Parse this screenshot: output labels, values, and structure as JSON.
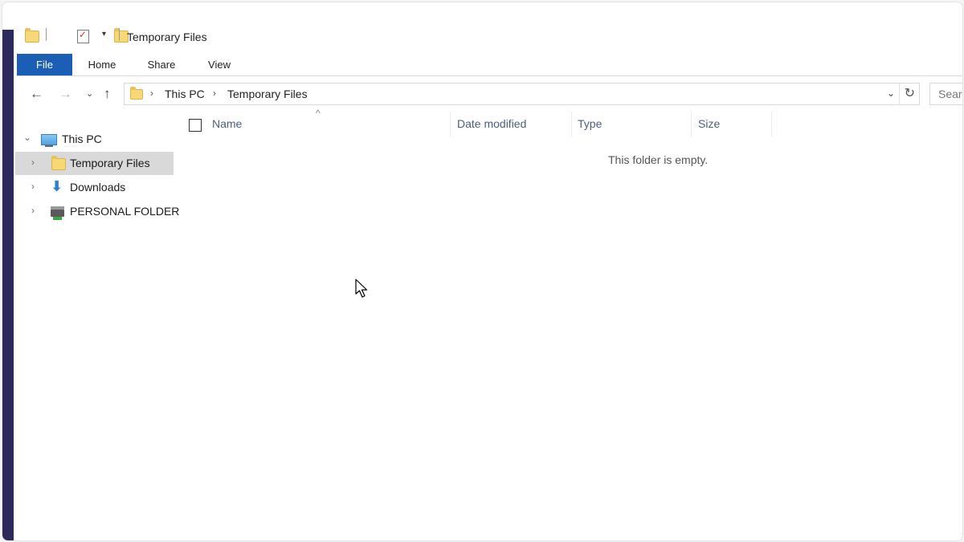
{
  "window": {
    "title": "Temporary Files",
    "quick_access_icons": [
      "folder-icon",
      "properties-icon",
      "new-folder-icon",
      "customize-dropdown-icon"
    ]
  },
  "ribbon": {
    "tabs": [
      "File",
      "Home",
      "Share",
      "View"
    ]
  },
  "address_bar": {
    "crumbs": [
      "This PC",
      "Temporary Files"
    ],
    "search_placeholder": "Search"
  },
  "nav_pane": {
    "root": "This PC",
    "items": [
      {
        "label": "Temporary Files",
        "icon": "folder-icon",
        "selected": true
      },
      {
        "label": "Downloads",
        "icon": "downloads-arrow-icon",
        "selected": false
      },
      {
        "label": "PERSONAL FOLDER",
        "icon": "network-drive-icon",
        "selected": false
      }
    ]
  },
  "file_list": {
    "columns": [
      "Name",
      "Date modified",
      "Type",
      "Size"
    ],
    "empty_message": "This folder is empty."
  },
  "colors": {
    "file_tab": "#1a5eb5",
    "left_strip": "#2c2a5c",
    "selected_row": "#d9d9d9"
  }
}
